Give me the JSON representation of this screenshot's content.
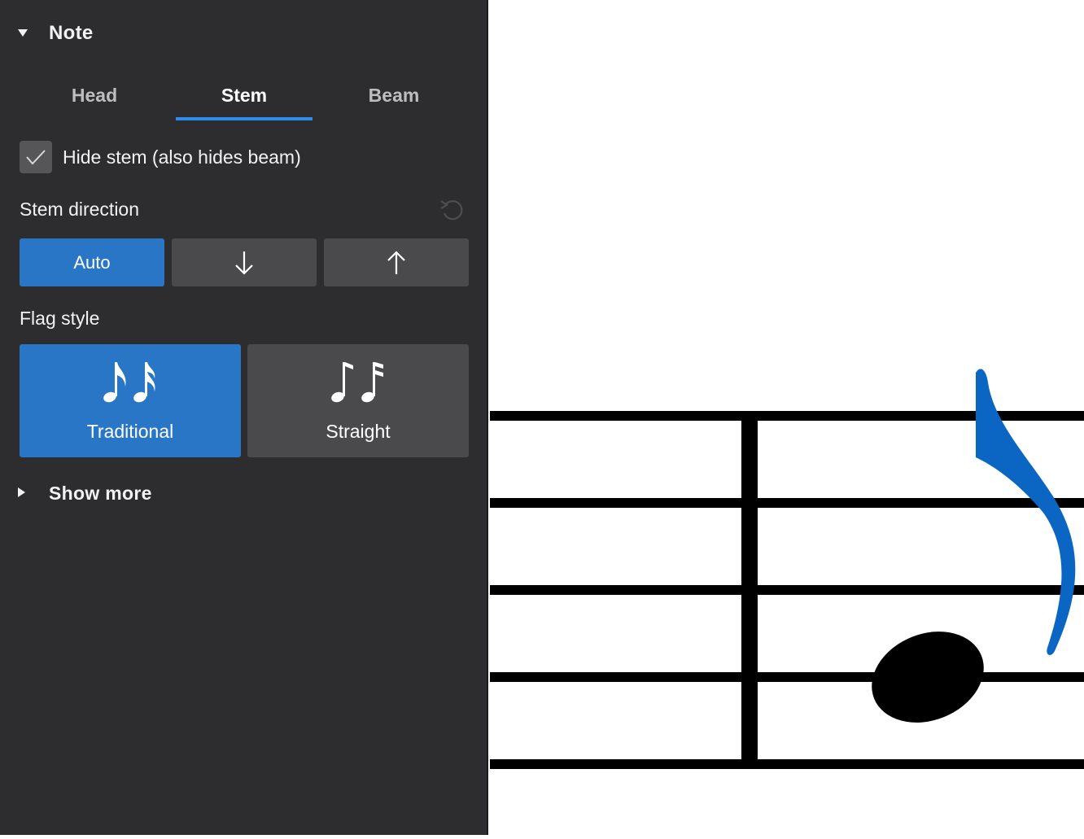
{
  "section": {
    "title": "Note",
    "toggle_icon": "triangle-down-icon"
  },
  "tabs": [
    {
      "label": "Head",
      "active": false
    },
    {
      "label": "Stem",
      "active": true
    },
    {
      "label": "Beam",
      "active": false
    }
  ],
  "hide_stem": {
    "label": "Hide stem (also hides beam)",
    "checked": true
  },
  "stem_direction": {
    "label": "Stem direction",
    "reset_icon": "undo-icon",
    "options": [
      {
        "label": "Auto",
        "active": true
      },
      {
        "label": "↓",
        "icon": "arrow-down-icon",
        "active": false
      },
      {
        "label": "↑",
        "icon": "arrow-up-icon",
        "active": false
      }
    ]
  },
  "flag_style": {
    "label": "Flag style",
    "options": [
      {
        "label": "Traditional",
        "icon": "traditional-flags-icon",
        "active": true
      },
      {
        "label": "Straight",
        "icon": "straight-flags-icon",
        "active": false
      }
    ]
  },
  "show_more": {
    "label": "Show more",
    "toggle_icon": "triangle-right-icon"
  },
  "colors": {
    "panel_bg": "#2d2d2f",
    "accent": "#2a76c6",
    "tab_underline": "#2e8ef0",
    "button_bg": "#4a4a4c",
    "selected_flag": "#0a66c2"
  }
}
